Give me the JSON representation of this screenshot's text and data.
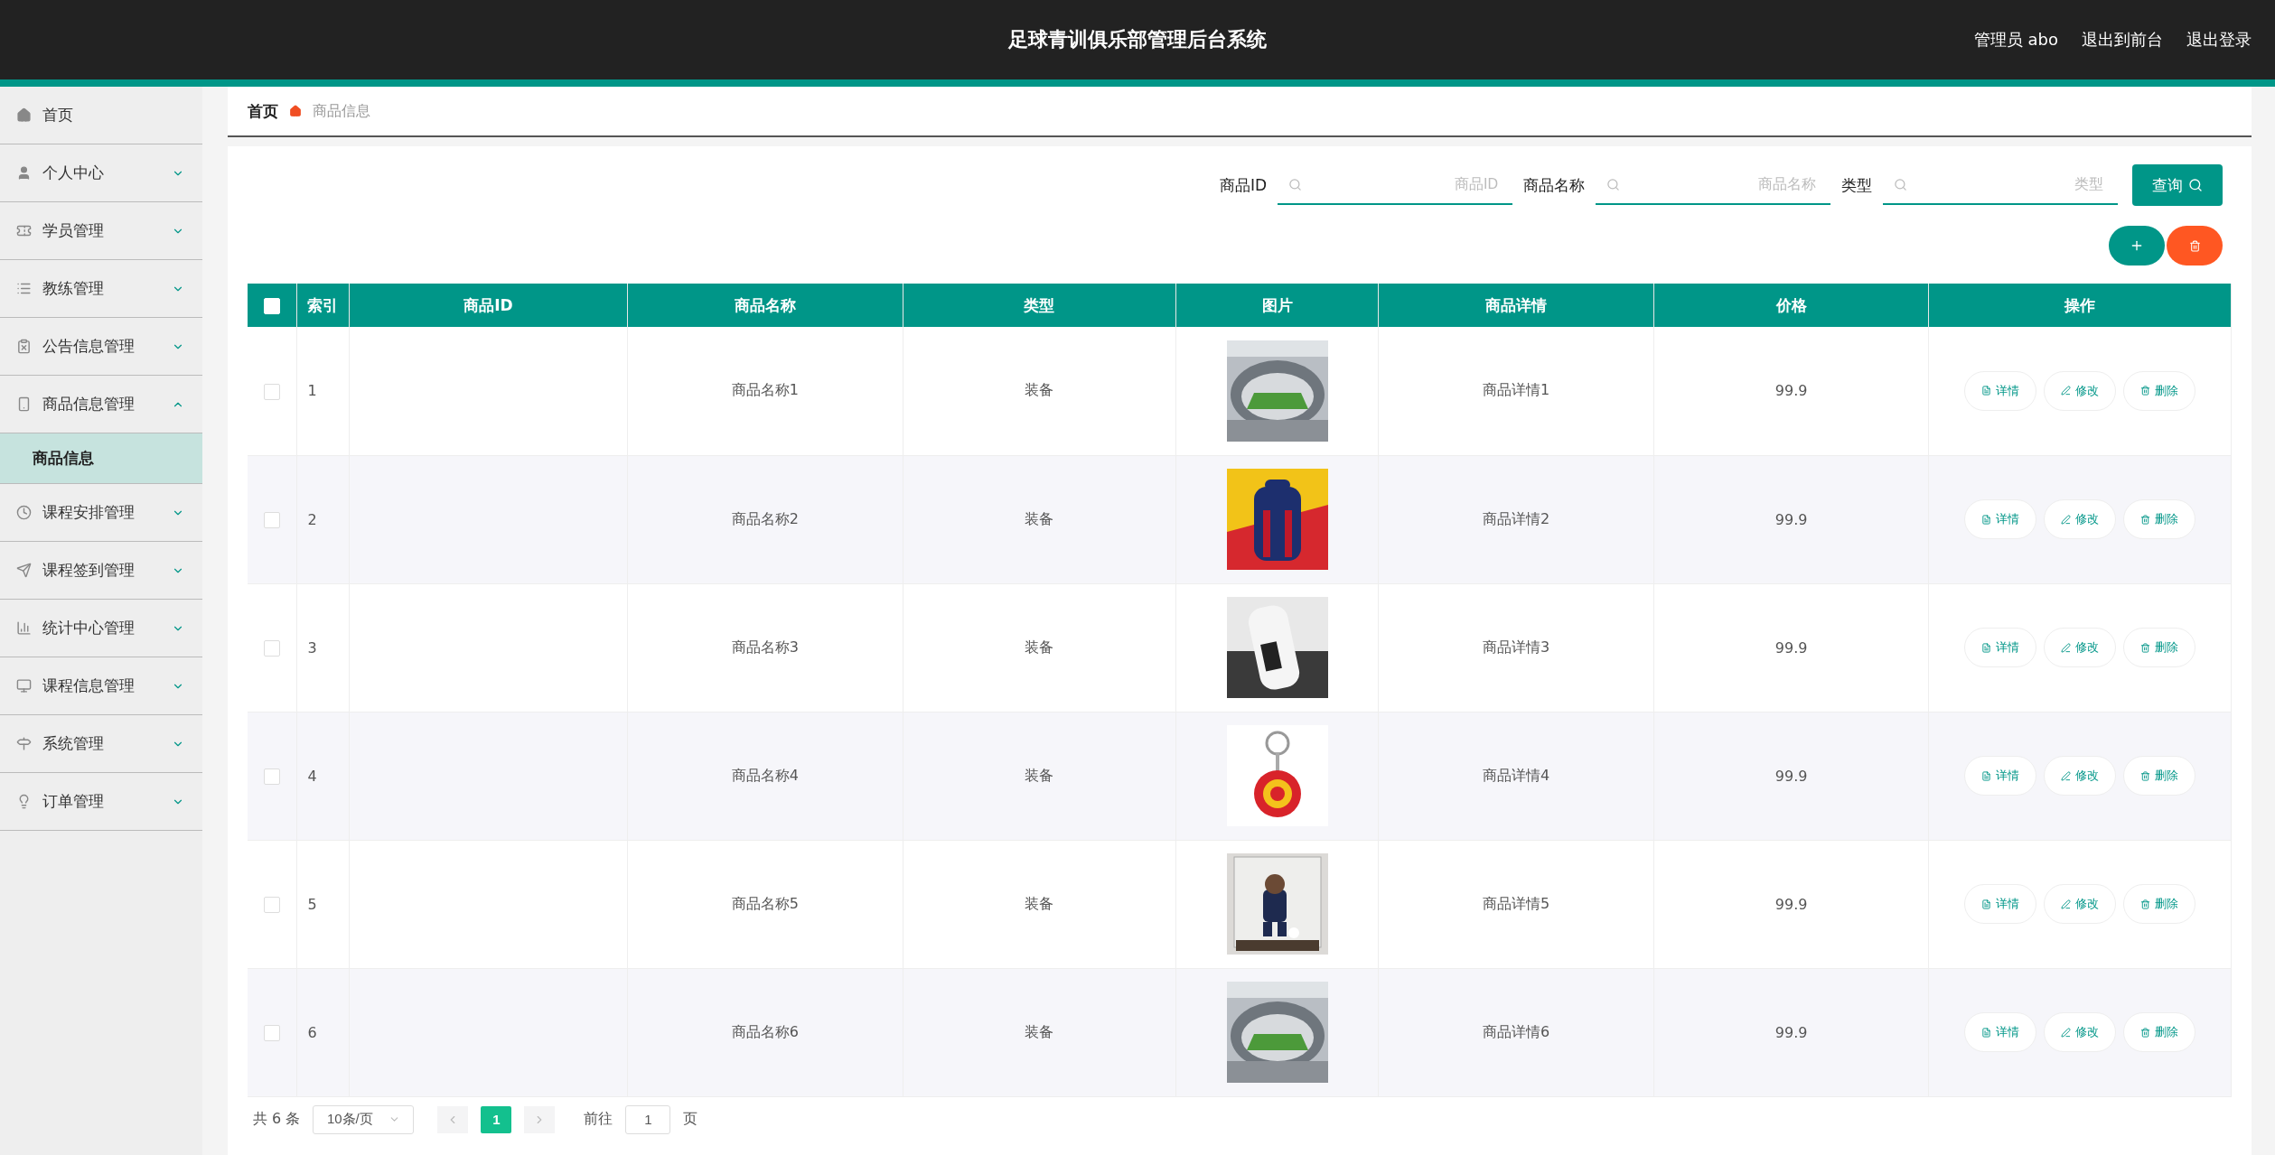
{
  "header": {
    "title": "足球青训俱乐部管理后台系统",
    "user": "管理员 abo",
    "links": [
      "退出到前台",
      "退出登录"
    ]
  },
  "sidebar": {
    "items": [
      {
        "label": "首页",
        "selected": false
      },
      {
        "label": "个人中心",
        "expanded": false,
        "selected": false
      },
      {
        "label": "学员管理",
        "expanded": false,
        "selected": false
      },
      {
        "label": "教练管理",
        "expanded": false,
        "selected": false
      },
      {
        "label": "公告信息管理",
        "expanded": false,
        "selected": false
      },
      {
        "label": "商品信息管理",
        "expanded": true,
        "selected": false,
        "children": [
          {
            "label": "商品信息",
            "selected": true
          }
        ]
      },
      {
        "label": "课程安排管理",
        "expanded": false,
        "selected": false
      },
      {
        "label": "课程签到管理",
        "expanded": false,
        "selected": false
      },
      {
        "label": "统计中心管理",
        "expanded": false,
        "selected": false
      },
      {
        "label": "课程信息管理",
        "expanded": false,
        "selected": false
      },
      {
        "label": "系统管理",
        "expanded": false,
        "selected": false
      },
      {
        "label": "订单管理",
        "expanded": false,
        "selected": false
      }
    ]
  },
  "breadcrumb": [
    "首页",
    "商品信息"
  ],
  "search": {
    "fields": [
      {
        "label": "商品ID",
        "placeholder": "商品ID"
      },
      {
        "label": "商品名称",
        "placeholder": "商品名称"
      },
      {
        "label": "类型",
        "placeholder": "类型"
      }
    ],
    "button": "查询"
  },
  "table": {
    "all_checked": false,
    "columns": [
      "索引",
      "商品ID",
      "商品名称",
      "类型",
      "图片",
      "商品详情",
      "价格",
      "操作"
    ],
    "rows": [
      {
        "checked": false,
        "index": "1",
        "name": "商品名称1",
        "type": "装备",
        "detail": "商品详情1",
        "price": "99.9",
        "actions": [
          "详情",
          "修改",
          "删除"
        ]
      },
      {
        "checked": false,
        "index": "2",
        "name": "商品名称2",
        "type": "装备",
        "detail": "商品详情2",
        "price": "99.9",
        "actions": [
          "详情",
          "修改",
          "删除"
        ]
      },
      {
        "checked": false,
        "index": "3",
        "name": "商品名称3",
        "type": "装备",
        "detail": "商品详情3",
        "price": "99.9",
        "actions": [
          "详情",
          "修改",
          "删除"
        ]
      },
      {
        "checked": false,
        "index": "4",
        "name": "商品名称4",
        "type": "装备",
        "detail": "商品详情4",
        "price": "99.9",
        "actions": [
          "详情",
          "修改",
          "删除"
        ]
      },
      {
        "checked": false,
        "index": "5",
        "name": "商品名称5",
        "type": "装备",
        "detail": "商品详情5",
        "price": "99.9",
        "actions": [
          "详情",
          "修改",
          "删除"
        ]
      },
      {
        "checked": false,
        "index": "6",
        "name": "商品名称6",
        "type": "装备",
        "detail": "商品详情6",
        "price": "99.9",
        "actions": [
          "详情",
          "修改",
          "删除"
        ]
      }
    ]
  },
  "pagination": {
    "total": "共 6 条",
    "page_size": "10条/页",
    "pages": [
      {
        "label": "1",
        "selected": true
      }
    ],
    "goto_label": "前往",
    "goto_value": "1",
    "goto_suffix": "页"
  }
}
